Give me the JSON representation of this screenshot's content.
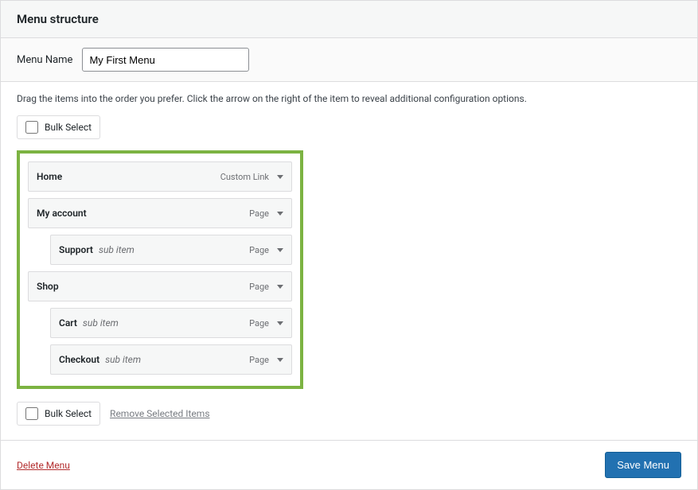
{
  "header": {
    "title": "Menu structure"
  },
  "menuName": {
    "label": "Menu Name",
    "value": "My First Menu"
  },
  "instructions": "Drag the items into the order you prefer. Click the arrow on the right of the item to reveal additional configuration options.",
  "bulkSelect": {
    "label": "Bulk Select"
  },
  "removeSelected": "Remove Selected Items",
  "subItemLabel": "sub item",
  "menuItems": [
    {
      "title": "Home",
      "type": "Custom Link",
      "depth": 0
    },
    {
      "title": "My account",
      "type": "Page",
      "depth": 0
    },
    {
      "title": "Support",
      "type": "Page",
      "depth": 1
    },
    {
      "title": "Shop",
      "type": "Page",
      "depth": 0
    },
    {
      "title": "Cart",
      "type": "Page",
      "depth": 1
    },
    {
      "title": "Checkout",
      "type": "Page",
      "depth": 1
    }
  ],
  "footer": {
    "deleteMenu": "Delete Menu",
    "saveMenu": "Save Menu"
  }
}
